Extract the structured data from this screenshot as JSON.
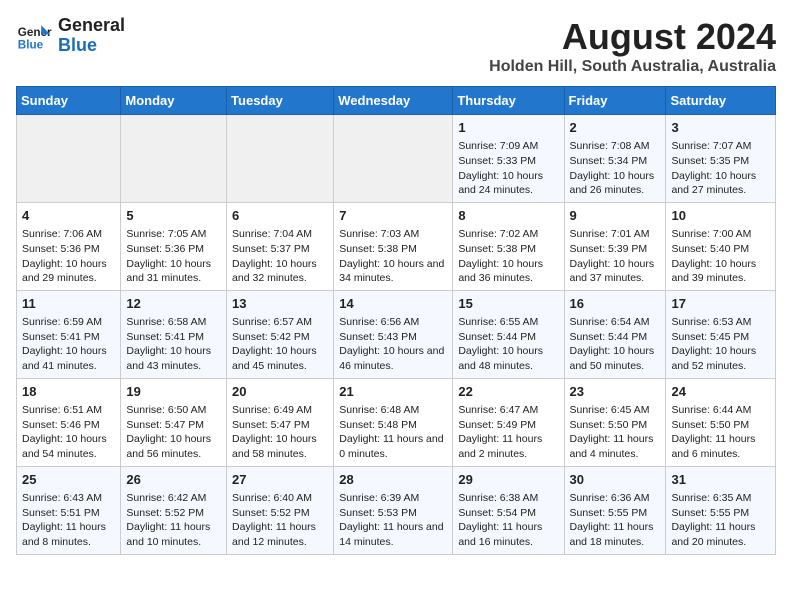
{
  "header": {
    "logo_line1": "General",
    "logo_line2": "Blue",
    "title": "August 2024",
    "subtitle": "Holden Hill, South Australia, Australia"
  },
  "days_of_week": [
    "Sunday",
    "Monday",
    "Tuesday",
    "Wednesday",
    "Thursday",
    "Friday",
    "Saturday"
  ],
  "weeks": [
    [
      {
        "day": "",
        "info": ""
      },
      {
        "day": "",
        "info": ""
      },
      {
        "day": "",
        "info": ""
      },
      {
        "day": "",
        "info": ""
      },
      {
        "day": "1",
        "sunrise": "7:09 AM",
        "sunset": "5:33 PM",
        "daylight": "10 hours and 24 minutes."
      },
      {
        "day": "2",
        "sunrise": "7:08 AM",
        "sunset": "5:34 PM",
        "daylight": "10 hours and 26 minutes."
      },
      {
        "day": "3",
        "sunrise": "7:07 AM",
        "sunset": "5:35 PM",
        "daylight": "10 hours and 27 minutes."
      }
    ],
    [
      {
        "day": "4",
        "sunrise": "7:06 AM",
        "sunset": "5:36 PM",
        "daylight": "10 hours and 29 minutes."
      },
      {
        "day": "5",
        "sunrise": "7:05 AM",
        "sunset": "5:36 PM",
        "daylight": "10 hours and 31 minutes."
      },
      {
        "day": "6",
        "sunrise": "7:04 AM",
        "sunset": "5:37 PM",
        "daylight": "10 hours and 32 minutes."
      },
      {
        "day": "7",
        "sunrise": "7:03 AM",
        "sunset": "5:38 PM",
        "daylight": "10 hours and 34 minutes."
      },
      {
        "day": "8",
        "sunrise": "7:02 AM",
        "sunset": "5:38 PM",
        "daylight": "10 hours and 36 minutes."
      },
      {
        "day": "9",
        "sunrise": "7:01 AM",
        "sunset": "5:39 PM",
        "daylight": "10 hours and 37 minutes."
      },
      {
        "day": "10",
        "sunrise": "7:00 AM",
        "sunset": "5:40 PM",
        "daylight": "10 hours and 39 minutes."
      }
    ],
    [
      {
        "day": "11",
        "sunrise": "6:59 AM",
        "sunset": "5:41 PM",
        "daylight": "10 hours and 41 minutes."
      },
      {
        "day": "12",
        "sunrise": "6:58 AM",
        "sunset": "5:41 PM",
        "daylight": "10 hours and 43 minutes."
      },
      {
        "day": "13",
        "sunrise": "6:57 AM",
        "sunset": "5:42 PM",
        "daylight": "10 hours and 45 minutes."
      },
      {
        "day": "14",
        "sunrise": "6:56 AM",
        "sunset": "5:43 PM",
        "daylight": "10 hours and 46 minutes."
      },
      {
        "day": "15",
        "sunrise": "6:55 AM",
        "sunset": "5:44 PM",
        "daylight": "10 hours and 48 minutes."
      },
      {
        "day": "16",
        "sunrise": "6:54 AM",
        "sunset": "5:44 PM",
        "daylight": "10 hours and 50 minutes."
      },
      {
        "day": "17",
        "sunrise": "6:53 AM",
        "sunset": "5:45 PM",
        "daylight": "10 hours and 52 minutes."
      }
    ],
    [
      {
        "day": "18",
        "sunrise": "6:51 AM",
        "sunset": "5:46 PM",
        "daylight": "10 hours and 54 minutes."
      },
      {
        "day": "19",
        "sunrise": "6:50 AM",
        "sunset": "5:47 PM",
        "daylight": "10 hours and 56 minutes."
      },
      {
        "day": "20",
        "sunrise": "6:49 AM",
        "sunset": "5:47 PM",
        "daylight": "10 hours and 58 minutes."
      },
      {
        "day": "21",
        "sunrise": "6:48 AM",
        "sunset": "5:48 PM",
        "daylight": "11 hours and 0 minutes."
      },
      {
        "day": "22",
        "sunrise": "6:47 AM",
        "sunset": "5:49 PM",
        "daylight": "11 hours and 2 minutes."
      },
      {
        "day": "23",
        "sunrise": "6:45 AM",
        "sunset": "5:50 PM",
        "daylight": "11 hours and 4 minutes."
      },
      {
        "day": "24",
        "sunrise": "6:44 AM",
        "sunset": "5:50 PM",
        "daylight": "11 hours and 6 minutes."
      }
    ],
    [
      {
        "day": "25",
        "sunrise": "6:43 AM",
        "sunset": "5:51 PM",
        "daylight": "11 hours and 8 minutes."
      },
      {
        "day": "26",
        "sunrise": "6:42 AM",
        "sunset": "5:52 PM",
        "daylight": "11 hours and 10 minutes."
      },
      {
        "day": "27",
        "sunrise": "6:40 AM",
        "sunset": "5:52 PM",
        "daylight": "11 hours and 12 minutes."
      },
      {
        "day": "28",
        "sunrise": "6:39 AM",
        "sunset": "5:53 PM",
        "daylight": "11 hours and 14 minutes."
      },
      {
        "day": "29",
        "sunrise": "6:38 AM",
        "sunset": "5:54 PM",
        "daylight": "11 hours and 16 minutes."
      },
      {
        "day": "30",
        "sunrise": "6:36 AM",
        "sunset": "5:55 PM",
        "daylight": "11 hours and 18 minutes."
      },
      {
        "day": "31",
        "sunrise": "6:35 AM",
        "sunset": "5:55 PM",
        "daylight": "11 hours and 20 minutes."
      }
    ]
  ]
}
